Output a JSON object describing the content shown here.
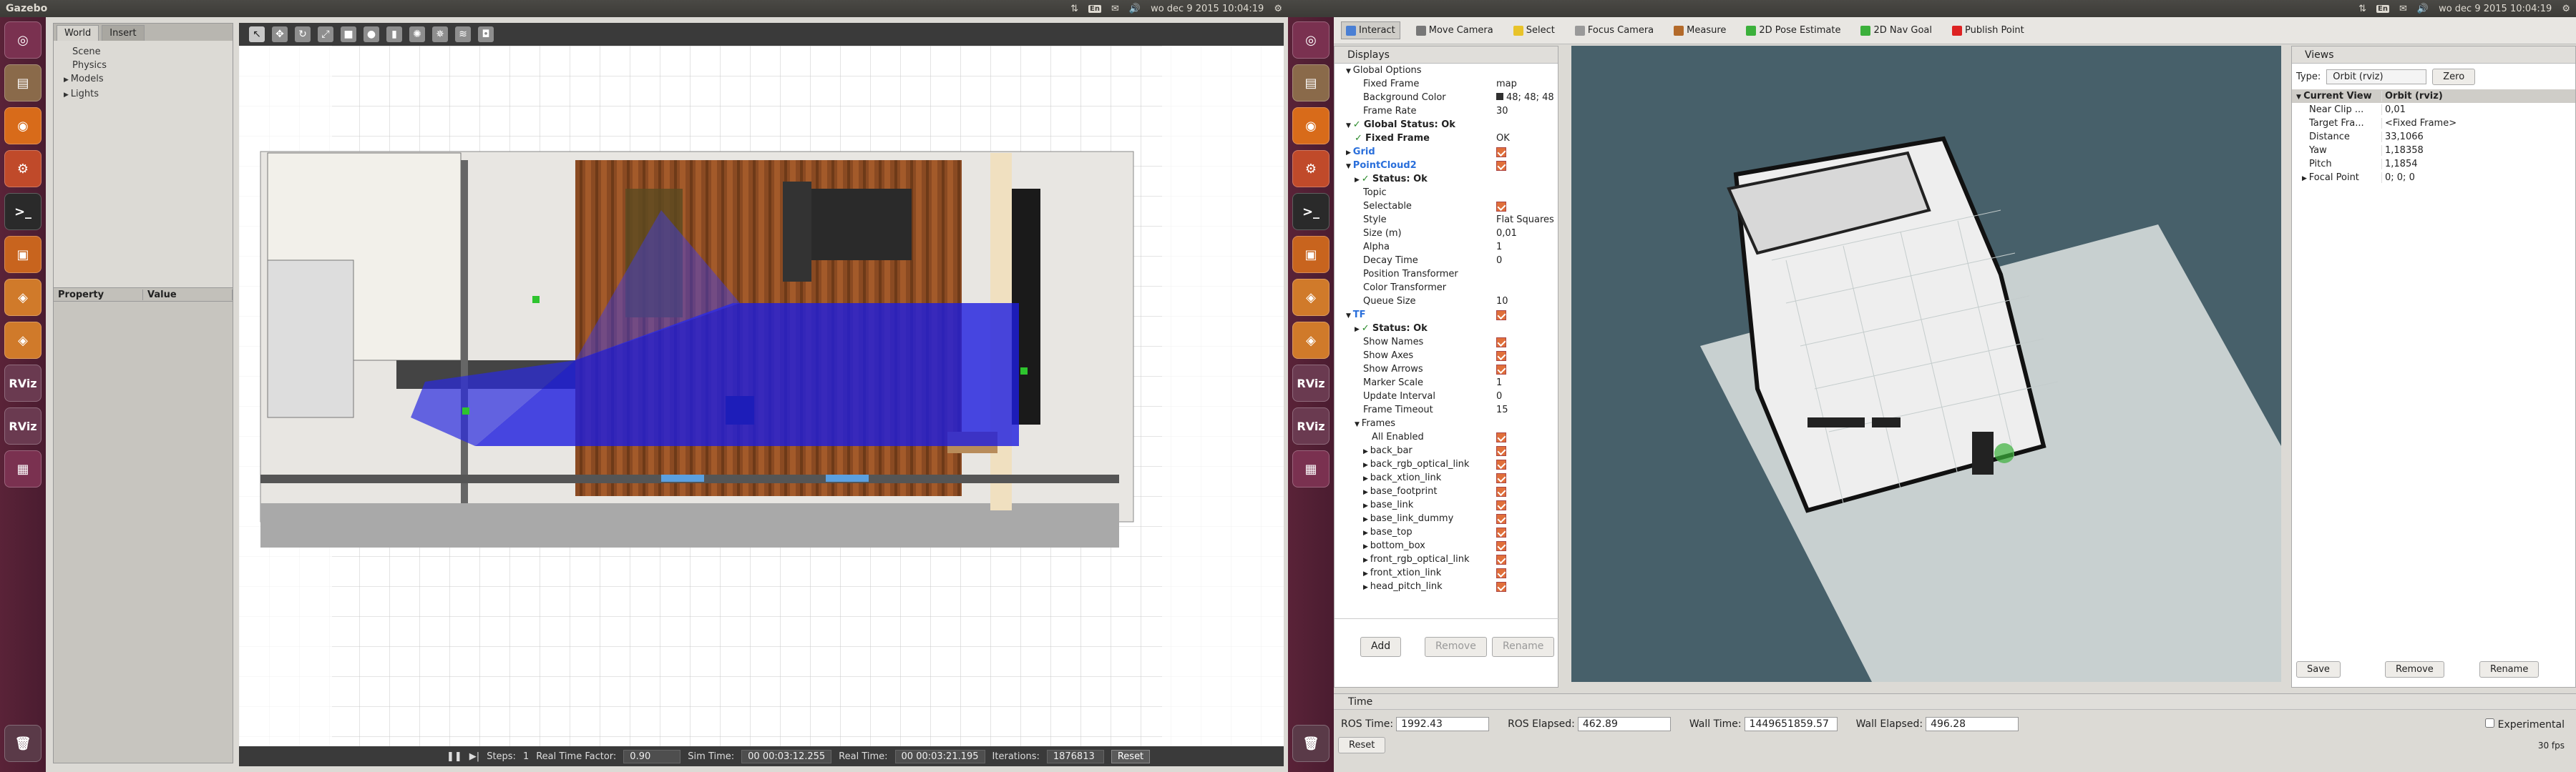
{
  "left_screen": {
    "topbar": {
      "title": "Gazebo",
      "keyboard": "En",
      "datetime": "wo dec  9 2015 10:04:19"
    },
    "tabs": [
      "World",
      "Insert"
    ],
    "tree": [
      "Scene",
      "Physics",
      "Models",
      "Lights"
    ],
    "property_headers": {
      "property": "Property",
      "value": "Value"
    },
    "statusbar": {
      "steps_label": "Steps:",
      "steps_value": "1",
      "rtf_label": "Real Time Factor:",
      "rtf_value": "0.90",
      "sim_label": "Sim Time:",
      "sim_value": "00 00:03:12.255",
      "real_label": "Real Time:",
      "real_value": "00 00:03:21.195",
      "iter_label": "Iterations:",
      "iter_value": "1876813",
      "reset_label": "Reset"
    }
  },
  "launcher": [
    "ubuntu-dash-icon",
    "files-icon",
    "firefox-icon",
    "settings-icon",
    "terminal-icon",
    "presentation-icon",
    "box-icon",
    "box-icon",
    "RViz",
    "RViz",
    "workspace-icon"
  ],
  "right_screen": {
    "topbar": {
      "keyboard": "En",
      "datetime": "wo dec  9 2015 10:04:19"
    },
    "toolbar": [
      {
        "label": "Interact",
        "icon": "#4a7fd4",
        "selected": true
      },
      {
        "label": "Move Camera",
        "icon": "#777"
      },
      {
        "label": "Select",
        "icon": "#e8c32a"
      },
      {
        "label": "Focus Camera",
        "icon": "#999"
      },
      {
        "label": "Measure",
        "icon": "#b36a2a"
      },
      {
        "label": "2D Pose Estimate",
        "icon": "#3bb03b"
      },
      {
        "label": "2D Nav Goal",
        "icon": "#3bb03b"
      },
      {
        "label": "Publish Point",
        "icon": "#d22"
      }
    ],
    "displays": {
      "title": "Displays",
      "rows": [
        {
          "k": "Global Options",
          "v": "",
          "indent": 1,
          "arrow": "▼",
          "cls": ""
        },
        {
          "k": "Fixed Frame",
          "v": "map",
          "indent": 3
        },
        {
          "k": "Background Color",
          "v": "48; 48; 48",
          "indent": 3,
          "swatch": true
        },
        {
          "k": "Frame Rate",
          "v": "30",
          "indent": 3
        },
        {
          "k": "Global Status: Ok",
          "v": "",
          "indent": 1,
          "arrow": "▼",
          "check": true,
          "cls": "bold"
        },
        {
          "k": "Fixed Frame",
          "v": "OK",
          "indent": 2,
          "arrow": "",
          "check": true,
          "cls": "bold"
        },
        {
          "k": "Grid",
          "v": "",
          "indent": 1,
          "arrow": "▶",
          "cls": "blue",
          "cb": true
        },
        {
          "k": "PointCloud2",
          "v": "",
          "indent": 1,
          "arrow": "▼",
          "cls": "blue",
          "cb": true
        },
        {
          "k": "Status: Ok",
          "v": "",
          "indent": 2,
          "arrow": "▶",
          "check": true,
          "cls": "bold"
        },
        {
          "k": "Topic",
          "v": "",
          "indent": 3
        },
        {
          "k": "Selectable",
          "v": "",
          "indent": 3,
          "cb": true
        },
        {
          "k": "Style",
          "v": "Flat Squares",
          "indent": 3
        },
        {
          "k": "Size (m)",
          "v": "0,01",
          "indent": 3
        },
        {
          "k": "Alpha",
          "v": "1",
          "indent": 3
        },
        {
          "k": "Decay Time",
          "v": "0",
          "indent": 3
        },
        {
          "k": "Position Transformer",
          "v": "",
          "indent": 3
        },
        {
          "k": "Color Transformer",
          "v": "",
          "indent": 3
        },
        {
          "k": "Queue Size",
          "v": "10",
          "indent": 3
        },
        {
          "k": "TF",
          "v": "",
          "indent": 1,
          "arrow": "▼",
          "cls": "blue",
          "cb": true
        },
        {
          "k": "Status: Ok",
          "v": "",
          "indent": 2,
          "arrow": "▶",
          "check": true,
          "cls": "bold"
        },
        {
          "k": "Show Names",
          "v": "",
          "indent": 3,
          "cb": true
        },
        {
          "k": "Show Axes",
          "v": "",
          "indent": 3,
          "cb": true
        },
        {
          "k": "Show Arrows",
          "v": "",
          "indent": 3,
          "cb": true
        },
        {
          "k": "Marker Scale",
          "v": "1",
          "indent": 3
        },
        {
          "k": "Update Interval",
          "v": "0",
          "indent": 3
        },
        {
          "k": "Frame Timeout",
          "v": "15",
          "indent": 3
        },
        {
          "k": "Frames",
          "v": "",
          "indent": 2,
          "arrow": "▼"
        },
        {
          "k": "All Enabled",
          "v": "",
          "indent": 4,
          "cb": true
        },
        {
          "k": "back_bar",
          "v": "",
          "indent": 3,
          "arrow": "▶",
          "cb": true
        },
        {
          "k": "back_rgb_optical_link",
          "v": "",
          "indent": 3,
          "arrow": "▶",
          "cb": true
        },
        {
          "k": "back_xtion_link",
          "v": "",
          "indent": 3,
          "arrow": "▶",
          "cb": true
        },
        {
          "k": "base_footprint",
          "v": "",
          "indent": 3,
          "arrow": "▶",
          "cb": true
        },
        {
          "k": "base_link",
          "v": "",
          "indent": 3,
          "arrow": "▶",
          "cb": true
        },
        {
          "k": "base_link_dummy",
          "v": "",
          "indent": 3,
          "arrow": "▶",
          "cb": true
        },
        {
          "k": "base_top",
          "v": "",
          "indent": 3,
          "arrow": "▶",
          "cb": true
        },
        {
          "k": "bottom_box",
          "v": "",
          "indent": 3,
          "arrow": "▶",
          "cb": true
        },
        {
          "k": "front_rgb_optical_link",
          "v": "",
          "indent": 3,
          "arrow": "▶",
          "cb": true
        },
        {
          "k": "front_xtion_link",
          "v": "",
          "indent": 3,
          "arrow": "▶",
          "cb": true
        },
        {
          "k": "head_pitch_link",
          "v": "",
          "indent": 3,
          "arrow": "▶",
          "cb": true
        }
      ],
      "buttons": {
        "add": "Add",
        "remove": "Remove",
        "rename": "Rename"
      }
    },
    "views": {
      "title": "Views",
      "type_label": "Type:",
      "type_value": "Orbit (rviz)",
      "zero": "Zero",
      "rows": [
        {
          "k": "Current View",
          "v": "Orbit (rviz)",
          "head": true
        },
        {
          "k": "Near Clip ...",
          "v": "0,01"
        },
        {
          "k": "Target Fra...",
          "v": "<Fixed Frame>"
        },
        {
          "k": "Distance",
          "v": "33,1066"
        },
        {
          "k": "Yaw",
          "v": "1,18358"
        },
        {
          "k": "Pitch",
          "v": "1,1854"
        },
        {
          "k": "Focal Point",
          "v": "0; 0; 0",
          "arrow": true
        }
      ],
      "buttons": {
        "save": "Save",
        "remove": "Remove",
        "rename": "Rename"
      }
    },
    "time": {
      "title": "Time",
      "ros_time_label": "ROS Time:",
      "ros_time": "1992.43",
      "ros_elapsed_label": "ROS Elapsed:",
      "ros_elapsed": "462.89",
      "wall_time_label": "Wall Time:",
      "wall_time": "1449651859.57",
      "wall_elapsed_label": "Wall Elapsed:",
      "wall_elapsed": "496.28",
      "experimental": "Experimental",
      "reset": "Reset",
      "fps": "30 fps"
    }
  }
}
